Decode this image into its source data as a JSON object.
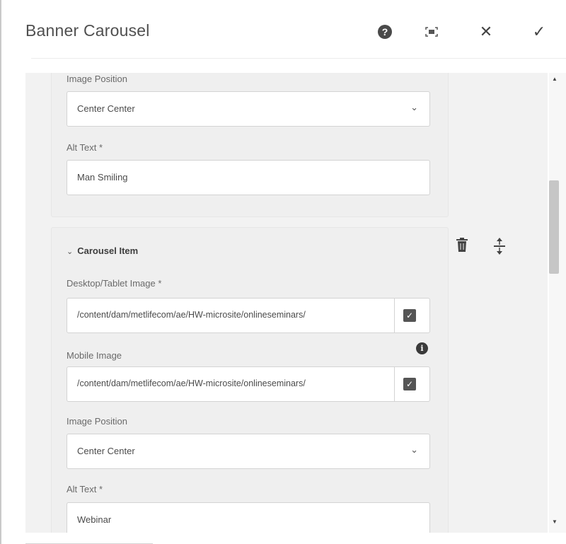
{
  "dialog": {
    "title": "Banner Carousel",
    "help_icon": "help-icon",
    "fullscreen_icon": "fullscreen-icon",
    "close_icon": "close-icon",
    "done_icon": "checkmark-icon"
  },
  "item1": {
    "image_position_label": "Image Position",
    "image_position_value": "Center Center",
    "alt_text_label": "Alt Text *",
    "alt_text_value": "Man Smiling"
  },
  "item2": {
    "header": "Carousel Item",
    "desktop_image_label": "Desktop/Tablet Image *",
    "desktop_image_value": "/content/dam/metlifecom/ae/HW-microsite/onlineseminars/",
    "mobile_image_label": "Mobile Image",
    "mobile_image_value": "/content/dam/metlifecom/ae/HW-microsite/onlineseminars/",
    "image_position_label": "Image Position",
    "image_position_value": "Center Center",
    "alt_text_label": "Alt Text *",
    "alt_text_value": "Webinar"
  },
  "icons": {
    "delete": "trash-icon",
    "reorder": "move-handle-icon",
    "info": "info-icon",
    "browse": "checkbox-icon",
    "chevron": "chevron-down-icon"
  }
}
